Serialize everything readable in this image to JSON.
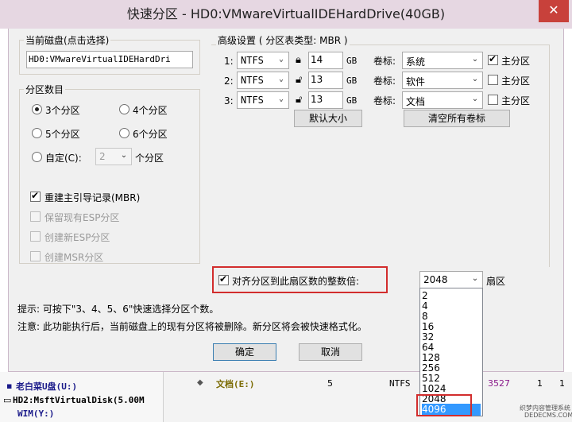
{
  "window": {
    "title": "快速分区 - HD0:VMwareVirtualIDEHardDrive(40GB)",
    "close": "✕"
  },
  "current_disk": {
    "legend": "当前磁盘(点击选择)",
    "value": "HD0:VMwareVirtualIDEHardDri"
  },
  "partition_count": {
    "legend": "分区数目",
    "options": [
      {
        "label": "3个分区",
        "selected": true
      },
      {
        "label": "4个分区",
        "selected": false
      },
      {
        "label": "5个分区",
        "selected": false
      },
      {
        "label": "6个分区",
        "selected": false
      }
    ],
    "custom_label": "自定(C):",
    "custom_value": "2",
    "custom_suffix": "个分区"
  },
  "options": {
    "rebuild_mbr": {
      "label": "重建主引导记录(MBR)",
      "checked": true
    },
    "keep_esp": {
      "label": "保留现有ESP分区",
      "checked": false
    },
    "create_esp": {
      "label": "创建新ESP分区",
      "checked": false
    },
    "create_msr": {
      "label": "创建MSR分区",
      "checked": false
    }
  },
  "advanced": {
    "legend": "高级设置 ( 分区表类型: MBR )",
    "rows": [
      {
        "idx": "1:",
        "fs": "NTFS",
        "size": "14",
        "unit": "GB",
        "vol_label": "卷标:",
        "name": "系统",
        "primary": true,
        "primary_label": "主分区"
      },
      {
        "idx": "2:",
        "fs": "NTFS",
        "size": "13",
        "unit": "GB",
        "vol_label": "卷标:",
        "name": "软件",
        "primary": false,
        "primary_label": "主分区"
      },
      {
        "idx": "3:",
        "fs": "NTFS",
        "size": "13",
        "unit": "GB",
        "vol_label": "卷标:",
        "name": "文档",
        "primary": false,
        "primary_label": "主分区"
      }
    ],
    "default_size_btn": "默认大小",
    "clear_labels_btn": "清空所有卷标"
  },
  "align": {
    "label": "对齐分区到此扇区数的整数倍:",
    "checked": true,
    "value": "2048",
    "suffix": "扇区"
  },
  "sector_options": [
    "2",
    "4",
    "8",
    "16",
    "32",
    "64",
    "128",
    "256",
    "512",
    "1024",
    "2048",
    "4096"
  ],
  "sector_highlight": "4096",
  "tips": {
    "line1": "提示: 可按下\"3、4、5、6\"快速选择分区个数。",
    "line2": "注意: 此功能执行后，当前磁盘上的现有分区将被删除。新分区将会被快速格式化。"
  },
  "buttons": {
    "ok": "确定",
    "cancel": "取消"
  },
  "background": {
    "disk_item1": "老白菜U盘(U:)",
    "disk_item2": "HD2:MsftVirtualDisk(5.00M",
    "disk_item3": "WIM(Y:)",
    "row_name": "文档(E:)",
    "row_num": "5",
    "row_fs": "NTFS",
    "row_val": "3527",
    "row_c1": "1",
    "row_c2": "1"
  },
  "watermark": {
    "line1": "织梦内容管理系统",
    "line2": "DEDECMS.COM"
  }
}
